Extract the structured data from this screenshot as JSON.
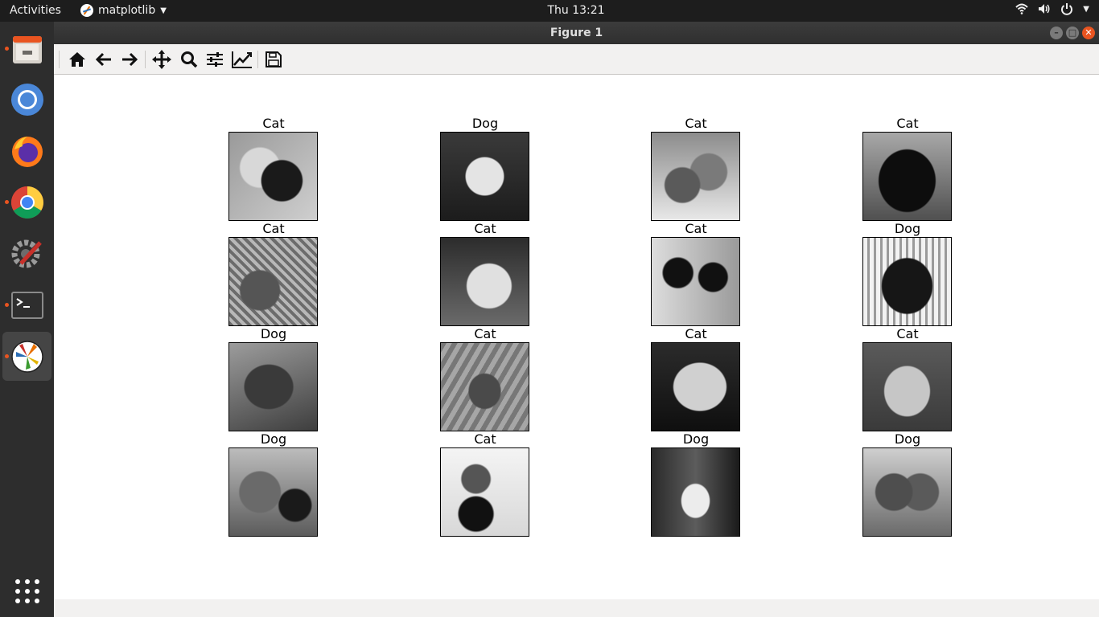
{
  "topbar": {
    "activities": "Activities",
    "app_name": "matplotlib",
    "clock": "Thu 13:21"
  },
  "window": {
    "title": "Figure 1"
  },
  "toolbar": {
    "tools": [
      "home-icon",
      "back-icon",
      "forward-icon",
      "pan-icon",
      "zoom-icon",
      "configure-subplots-icon",
      "edit-axes-icon",
      "save-icon"
    ]
  },
  "dock": {
    "items": [
      "files-icon",
      "chromium-icon",
      "firefox-icon",
      "chrome-icon",
      "settings-icon",
      "terminal-icon",
      "matplotlib-icon",
      "show-apps-icon"
    ]
  },
  "figure": {
    "labels": [
      [
        "Cat",
        "Dog",
        "Cat",
        "Cat"
      ],
      [
        "Cat",
        "Cat",
        "Cat",
        "Dog"
      ],
      [
        "Dog",
        "Cat",
        "Cat",
        "Cat"
      ],
      [
        "Dog",
        "Cat",
        "Dog",
        "Dog"
      ]
    ]
  }
}
